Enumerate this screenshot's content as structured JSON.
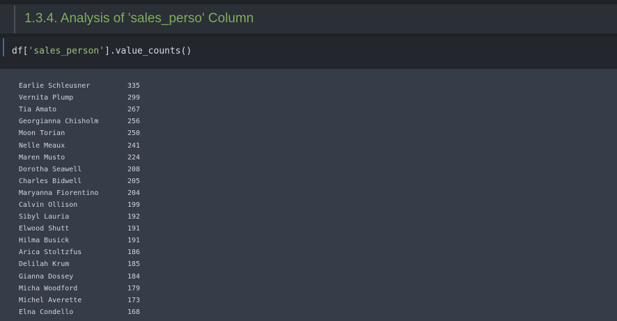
{
  "markdown": {
    "heading": "1.3.4. Analysis of 'sales_perso' Column"
  },
  "code": {
    "prefix": "df[",
    "string": "'sales_person'",
    "suffix": "].value_counts()"
  },
  "output": {
    "rows": [
      {
        "name": "Earlie Schleusner",
        "count": "335"
      },
      {
        "name": "Vernita Plump",
        "count": "299"
      },
      {
        "name": "Tia Amato",
        "count": "267"
      },
      {
        "name": "Georgianna Chisholm",
        "count": "256"
      },
      {
        "name": "Moon Torian",
        "count": "250"
      },
      {
        "name": "Nelle Meaux",
        "count": "241"
      },
      {
        "name": "Maren Musto",
        "count": "224"
      },
      {
        "name": "Dorotha Seawell",
        "count": "208"
      },
      {
        "name": "Charles Bidwell",
        "count": "205"
      },
      {
        "name": "Maryanna Fiorentino",
        "count": "204"
      },
      {
        "name": "Calvin Ollison",
        "count": "199"
      },
      {
        "name": "Sibyl Lauria",
        "count": "192"
      },
      {
        "name": "Elwood Shutt",
        "count": "191"
      },
      {
        "name": "Hilma Busick",
        "count": "191"
      },
      {
        "name": "Arica Stoltzfus",
        "count": "186"
      },
      {
        "name": "Delilah Krum",
        "count": "185"
      },
      {
        "name": "Gianna Dossey",
        "count": "184"
      },
      {
        "name": "Micha Woodford",
        "count": "179"
      },
      {
        "name": "Michel Averette",
        "count": "173"
      },
      {
        "name": "Elna Condello",
        "count": "168"
      }
    ]
  }
}
